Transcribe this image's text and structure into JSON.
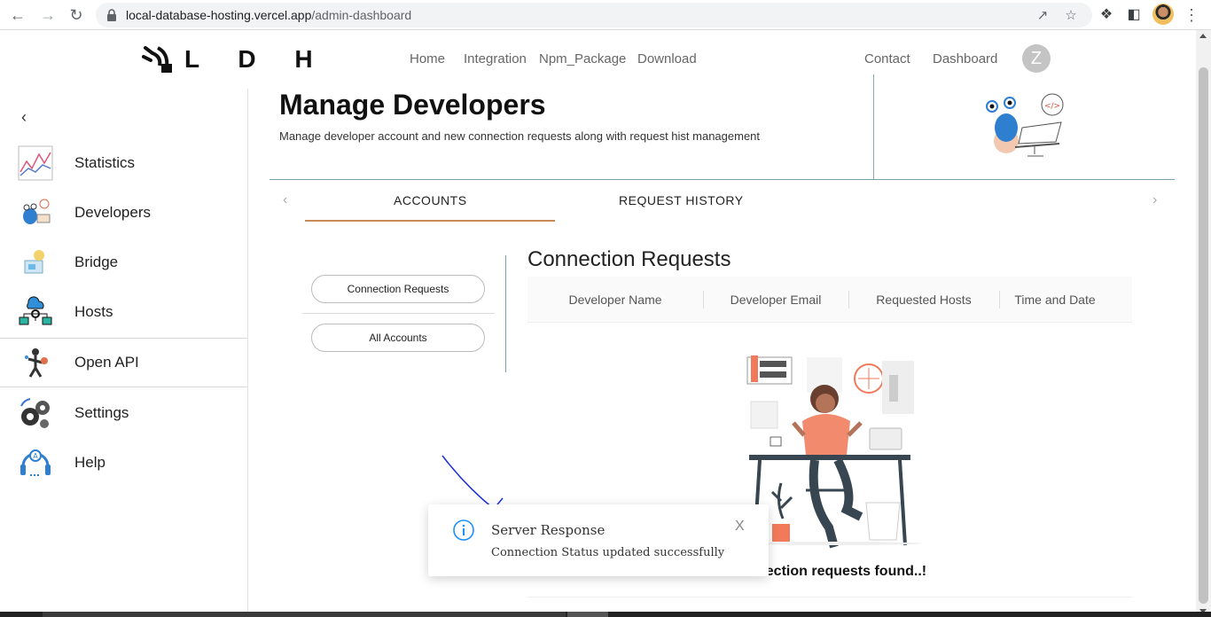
{
  "browser": {
    "url_host": "local-database-hosting.vercel.app",
    "url_path": "/admin-dashboard"
  },
  "brand": {
    "name": "L D H"
  },
  "nav": {
    "home": "Home",
    "integration": "Integration",
    "npm": "Npm_Package",
    "download": "Download",
    "contact": "Contact",
    "dashboard": "Dashboard",
    "avatar_initial": "Z"
  },
  "sidebar": {
    "items": [
      {
        "label": "Statistics",
        "icon": "statistics-chart-icon"
      },
      {
        "label": "Developers",
        "icon": "developers-icon"
      },
      {
        "label": "Bridge",
        "icon": "bridge-icon"
      },
      {
        "label": "Hosts",
        "icon": "hosts-network-icon"
      },
      {
        "label": "Open API",
        "icon": "open-api-icon"
      },
      {
        "label": "Settings",
        "icon": "settings-gears-icon"
      },
      {
        "label": "Help",
        "icon": "help-headset-icon"
      }
    ]
  },
  "page": {
    "title": "Manage Developers",
    "subtitle": "Manage developer account and new connection requests along with request hist management"
  },
  "tabs": {
    "accounts": "ACCOUNTS",
    "history": "REQUEST HISTORY"
  },
  "filters": {
    "connection_requests": "Connection Requests",
    "all_accounts": "All Accounts"
  },
  "table": {
    "title": "Connection Requests",
    "columns": [
      "Developer Name",
      "Developer Email",
      "Requested Hosts",
      "Time and Date"
    ],
    "rows": [],
    "empty_text": "nection requests found..!"
  },
  "toast": {
    "title": "Server Response",
    "message": "Connection Status updated successfully",
    "close": "X"
  },
  "colors": {
    "accent_underline": "#c98a5a",
    "divider": "#7a9fa8",
    "info_blue": "#1890ff"
  }
}
